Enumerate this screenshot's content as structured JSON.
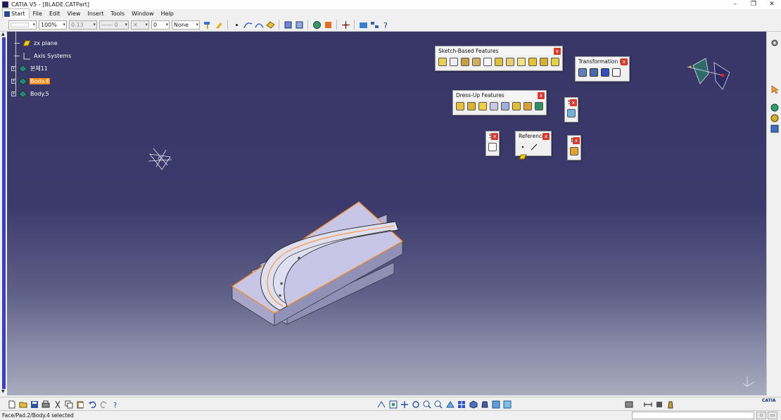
{
  "window": {
    "title": "CATIA V5 - [BLADE.CATPart]",
    "controls": [
      "–",
      "❐",
      "✕"
    ],
    "mdi_controls": [
      "–",
      "❐",
      "✕"
    ]
  },
  "menu": [
    {
      "label": "Start"
    },
    {
      "label": "File"
    },
    {
      "label": "Edit"
    },
    {
      "label": "View"
    },
    {
      "label": "Insert"
    },
    {
      "label": "Tools"
    },
    {
      "label": "Window"
    },
    {
      "label": "Help"
    }
  ],
  "toolbar": {
    "zoom": "100%",
    "thickness": "0.13 mm",
    "linetype": "—— 0",
    "point": "✕",
    "layer_prefix": "0",
    "layer": "None"
  },
  "tree": {
    "items": [
      {
        "label": "zx plane",
        "icon": "plane-icon"
      },
      {
        "label": "Axis Systems",
        "icon": "axis-icon"
      },
      {
        "label": "본체11",
        "icon": "body-icon"
      },
      {
        "label": "Body.4",
        "icon": "body-icon",
        "selected": true
      },
      {
        "label": "Body.5",
        "icon": "body-icon"
      }
    ]
  },
  "palettes": {
    "sketch": {
      "title": "Sketch-Based Features"
    },
    "transform": {
      "title": "Transformation Fe..."
    },
    "dressup": {
      "title": "Dress-Up Features"
    },
    "reference": {
      "title": "Reference..."
    },
    "small1": {
      "title": "S"
    },
    "small2": {
      "title": "S"
    },
    "small3": {
      "title": "B"
    }
  },
  "colors": {
    "accent": "#f28c1c",
    "viewport_top": "#383666",
    "part_face": "#c7c6e6",
    "part_side": "#a7a6c8",
    "edge_highlight": "#ff8c1a"
  },
  "status": {
    "message": "Face/Pad.2/Body.4 selected"
  }
}
